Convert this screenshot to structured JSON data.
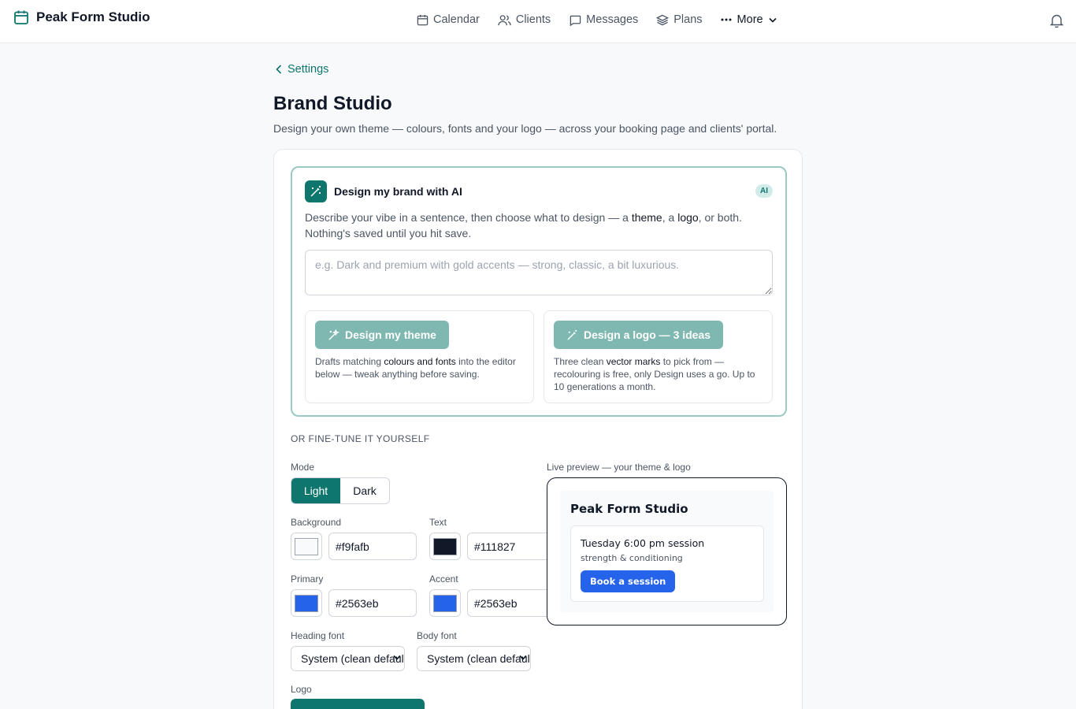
{
  "app": {
    "name": "Peak Form Studio"
  },
  "nav": {
    "items": [
      {
        "label": "Calendar",
        "icon": "calendar-icon"
      },
      {
        "label": "Clients",
        "icon": "users-icon"
      },
      {
        "label": "Messages",
        "icon": "message-icon"
      },
      {
        "label": "Plans",
        "icon": "layers-icon"
      }
    ],
    "more_label": "More"
  },
  "page": {
    "back_label": "Settings",
    "title": "Brand Studio",
    "subtitle": "Design your own theme — colours, fonts and your logo — across your booking page and clients' portal."
  },
  "ai": {
    "title": "Design my brand with AI",
    "badge": "AI",
    "desc_1": "Describe your vibe in a sentence, then choose what to design — a ",
    "desc_theme": "theme",
    "desc_2": ", a ",
    "desc_logo": "logo",
    "desc_3": ", or both. Nothing's saved until you hit save.",
    "placeholder": "e.g. Dark and premium with gold accents — strong, classic, a bit luxurious.",
    "theme_button": "Design my theme",
    "theme_desc_1": "Drafts matching ",
    "theme_desc_bold": "colours and fonts",
    "theme_desc_2": " into the editor below — tweak anything before saving.",
    "logo_button": "Design a logo — 3 ideas",
    "logo_desc_1": "Three clean ",
    "logo_desc_bold": "vector marks",
    "logo_desc_2": " to pick from — recolouring is free, only Design uses a go. Up to 10 generations a month."
  },
  "editor": {
    "section_label": "OR FINE-TUNE IT YOURSELF",
    "mode_label": "Mode",
    "mode_options": [
      "Light",
      "Dark"
    ],
    "mode_selected": "Light",
    "background_label": "Background",
    "background_value": "#f9fafb",
    "text_label": "Text",
    "text_value": "#111827",
    "primary_label": "Primary",
    "primary_value": "#2563eb",
    "accent_label": "Accent",
    "accent_value": "#2563eb",
    "heading_font_label": "Heading font",
    "heading_font_value": "System (clean default)",
    "body_font_label": "Body font",
    "body_font_value": "System (clean default)",
    "logo_label": "Logo"
  },
  "preview": {
    "label": "Live preview — your theme & logo",
    "brand": "Peak Form Studio",
    "session_title": "Tuesday 6:00 pm session",
    "session_sub": "strength & conditioning",
    "button": "Book a session"
  },
  "colors": {
    "brand_teal": "#0f766e",
    "swatch_background": "#f9fafb",
    "swatch_text": "#111827",
    "swatch_primary": "#2563eb",
    "swatch_accent": "#2563eb"
  }
}
